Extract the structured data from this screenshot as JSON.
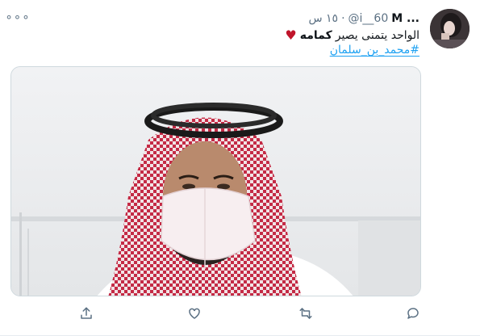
{
  "tweet": {
    "author_name": "M ...",
    "handle": "@i__60",
    "separator": "·",
    "time": "١٥ س",
    "text_plain": "الواحد يتمنى يصير",
    "text_bold": "كمامه",
    "hashtag": "#محمد_بن_سلمان"
  },
  "icons": {
    "more": "more-icon",
    "share": "share-icon",
    "like": "heart-icon",
    "retweet": "retweet-icon",
    "reply": "reply-icon"
  },
  "colors": {
    "link": "#1da1f2",
    "muted": "#5b7083",
    "heart_emoji": "#c0152b"
  }
}
